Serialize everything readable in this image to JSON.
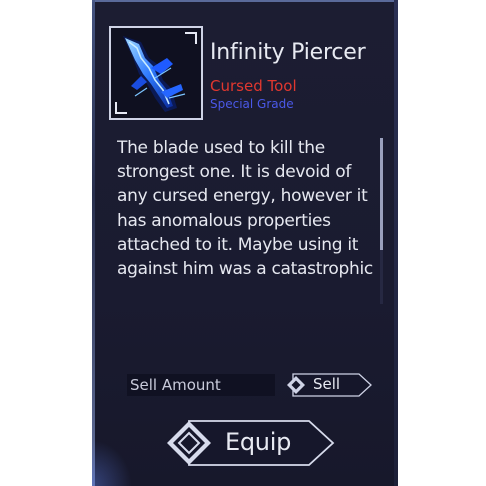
{
  "item": {
    "name": "Infinity Piercer",
    "type": "Cursed Tool",
    "grade": "Special Grade",
    "icon": "blade-icon",
    "description": "The blade used to kill the strongest one. It is devoid of any cursed energy, however it has anomalous properties attached to it. Maybe using it against him was a catastrophic"
  },
  "sell": {
    "placeholder": "Sell Amount",
    "button_label": "Sell"
  },
  "equip": {
    "button_label": "Equip"
  },
  "colors": {
    "panel_bg": "#1b1c31",
    "type_color": "#e0372f",
    "grade_color": "#4a58e8",
    "text": "#e8eaf2"
  }
}
